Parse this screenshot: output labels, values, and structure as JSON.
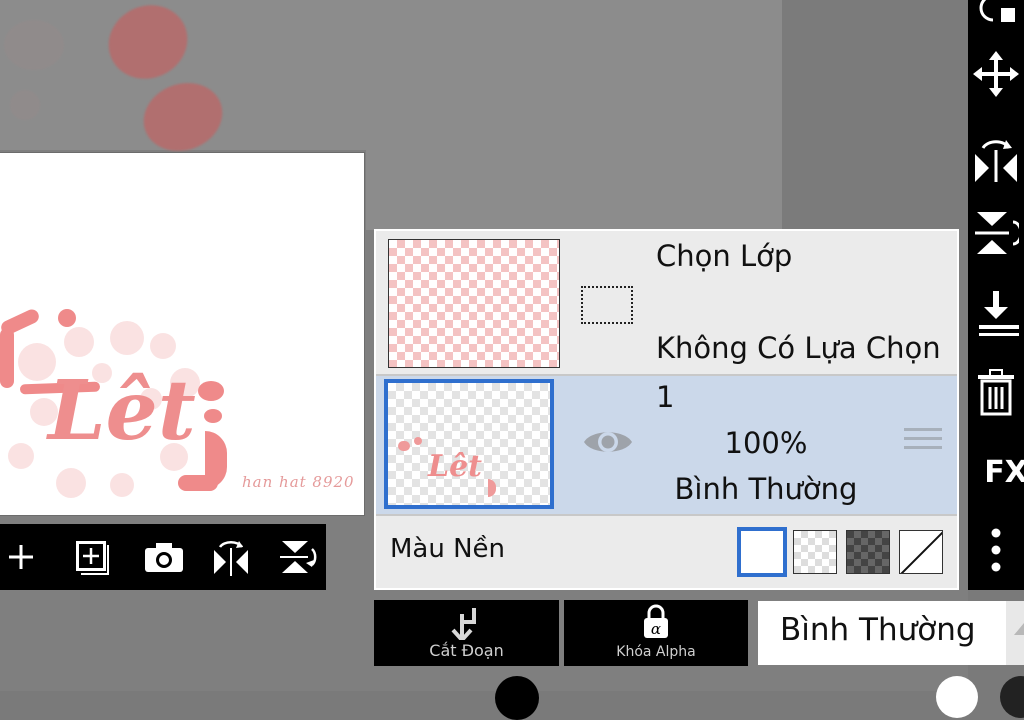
{
  "colors": {
    "accent": "#2f6fce",
    "toolbar": "#000000",
    "panel": "#ebebeb",
    "selected_layer": "#cbd8ea",
    "artwork_pink": "#ef8a8a"
  },
  "canvas": {
    "artwork_text": "Lêt",
    "signature": "han hat 8920"
  },
  "bottom_toolbar": {
    "items": [
      {
        "name": "add-layer-button",
        "icon": "plus-icon"
      },
      {
        "name": "add-copy-layer-button",
        "icon": "add-square-icon"
      },
      {
        "name": "camera-button",
        "icon": "camera-icon"
      },
      {
        "name": "flip-horizontal-button",
        "icon": "flip-horizontal-icon"
      },
      {
        "name": "flip-vertical-button",
        "icon": "flip-vertical-icon"
      }
    ]
  },
  "right_toolbar": {
    "fx_label": "FX",
    "icons": [
      "rotate-icon",
      "move-icon",
      "flip-horizontal-icon",
      "flip-vertical-icon",
      "merge-down-icon",
      "trash-icon",
      "fx-icon",
      "more-vertical-icon"
    ]
  },
  "layer_panel": {
    "selection": {
      "title": "Chọn Lớp",
      "subtitle": "Không Có Lựa Chọn"
    },
    "layer": {
      "number": "1",
      "opacity": "100%",
      "blend_mode": "Bình Thường",
      "visible": true
    },
    "background": {
      "label": "Màu Nền",
      "options": [
        "white",
        "light-checker",
        "dark-checker",
        "none"
      ],
      "selected": "white"
    }
  },
  "bottom_bar": {
    "clip_label": "Cắt Đoạn",
    "alpha_lock_label": "Khóa Alpha",
    "blend_mode_value": "Bình Thường"
  }
}
